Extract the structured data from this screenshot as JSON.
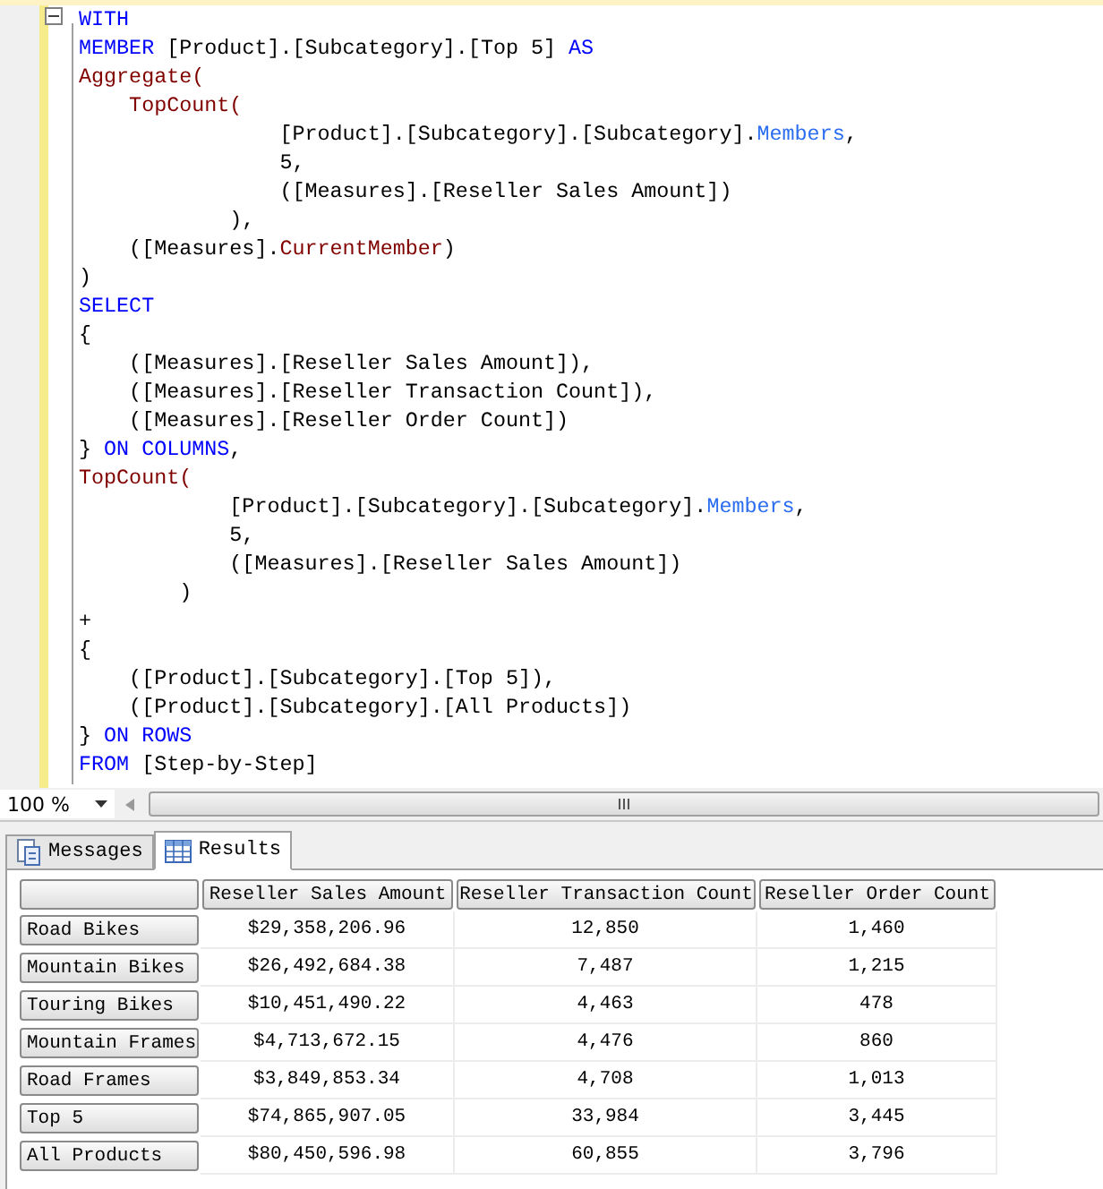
{
  "editor": {
    "lines": [
      [
        {
          "kind": "keyword",
          "text": "WITH"
        }
      ],
      [
        {
          "kind": "keyword",
          "text": "MEMBER"
        },
        {
          "kind": "plain",
          "text": " [Product].[Subcategory].[Top 5] "
        },
        {
          "kind": "keyword",
          "text": "AS"
        }
      ],
      [
        {
          "kind": "function",
          "text": "Aggregate("
        }
      ],
      [
        {
          "kind": "function",
          "text": "    TopCount("
        }
      ],
      [
        {
          "kind": "plain",
          "text": "                [Product].[Subcategory].[Subcategory]."
        },
        {
          "kind": "property",
          "text": "Members"
        },
        {
          "kind": "plain",
          "text": ","
        }
      ],
      [
        {
          "kind": "plain",
          "text": "                5,"
        }
      ],
      [
        {
          "kind": "plain",
          "text": "                ([Measures].[Reseller Sales Amount])"
        }
      ],
      [
        {
          "kind": "plain",
          "text": "            ),"
        }
      ],
      [
        {
          "kind": "plain",
          "text": "    ([Measures]."
        },
        {
          "kind": "function",
          "text": "CurrentMember"
        },
        {
          "kind": "plain",
          "text": ")"
        }
      ],
      [
        {
          "kind": "plain",
          "text": ")"
        }
      ],
      [
        {
          "kind": "keyword",
          "text": "SELECT"
        }
      ],
      [
        {
          "kind": "plain",
          "text": "{"
        }
      ],
      [
        {
          "kind": "plain",
          "text": "    ([Measures].[Reseller Sales Amount]),"
        }
      ],
      [
        {
          "kind": "plain",
          "text": "    ([Measures].[Reseller Transaction Count]),"
        }
      ],
      [
        {
          "kind": "plain",
          "text": "    ([Measures].[Reseller Order Count])"
        }
      ],
      [
        {
          "kind": "plain",
          "text": "} "
        },
        {
          "kind": "keyword",
          "text": "ON COLUMNS"
        },
        {
          "kind": "plain",
          "text": ","
        }
      ],
      [
        {
          "kind": "function",
          "text": "TopCount("
        }
      ],
      [
        {
          "kind": "plain",
          "text": "            [Product].[Subcategory].[Subcategory]."
        },
        {
          "kind": "property",
          "text": "Members"
        },
        {
          "kind": "plain",
          "text": ","
        }
      ],
      [
        {
          "kind": "plain",
          "text": "            5,"
        }
      ],
      [
        {
          "kind": "plain",
          "text": "            ([Measures].[Reseller Sales Amount])"
        }
      ],
      [
        {
          "kind": "plain",
          "text": "        )"
        }
      ],
      [
        {
          "kind": "plain",
          "text": "+"
        }
      ],
      [
        {
          "kind": "plain",
          "text": "{"
        }
      ],
      [
        {
          "kind": "plain",
          "text": "    ([Product].[Subcategory].[Top 5]),"
        }
      ],
      [
        {
          "kind": "plain",
          "text": "    ([Product].[Subcategory].[All Products])"
        }
      ],
      [
        {
          "kind": "plain",
          "text": "} "
        },
        {
          "kind": "keyword",
          "text": "ON ROWS"
        }
      ],
      [
        {
          "kind": "keyword",
          "text": "FROM"
        },
        {
          "kind": "plain",
          "text": " [Step-by-Step]"
        }
      ]
    ]
  },
  "zoom": {
    "value": "100 %"
  },
  "tabs": [
    {
      "label": "Messages",
      "kind": "messages",
      "selected": false
    },
    {
      "label": "Results",
      "kind": "grid",
      "selected": true
    }
  ],
  "table": {
    "columns": [
      "Reseller Sales Amount",
      "Reseller Transaction Count",
      "Reseller Order Count"
    ],
    "rows": [
      {
        "header": "Road Bikes",
        "cells": [
          "$29,358,206.96",
          "12,850",
          "1,460"
        ]
      },
      {
        "header": "Mountain Bikes",
        "cells": [
          "$26,492,684.38",
          "7,487",
          "1,215"
        ]
      },
      {
        "header": "Touring Bikes",
        "cells": [
          "$10,451,490.22",
          "4,463",
          "478"
        ]
      },
      {
        "header": "Mountain Frames",
        "cells": [
          "$4,713,672.15",
          "4,476",
          "860"
        ]
      },
      {
        "header": "Road Frames",
        "cells": [
          "$3,849,853.34",
          "4,708",
          "1,013"
        ]
      },
      {
        "header": "Top 5",
        "cells": [
          "$74,865,907.05",
          "33,984",
          "3,445"
        ]
      },
      {
        "header": "All Products",
        "cells": [
          "$80,450,596.98",
          "60,855",
          "3,796"
        ]
      }
    ]
  }
}
